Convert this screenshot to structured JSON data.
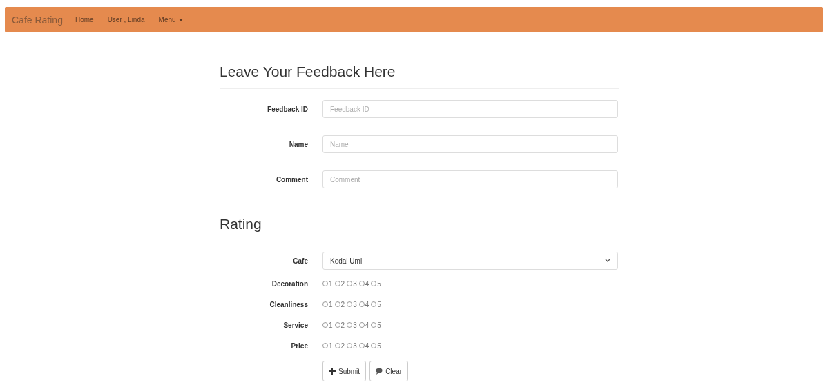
{
  "navbar": {
    "brand": "Cafe Rating",
    "links": [
      {
        "label": "Home",
        "kind": "link"
      },
      {
        "label": "User , Linda",
        "kind": "link"
      },
      {
        "label": "Menu",
        "kind": "dropdown"
      }
    ]
  },
  "feedback": {
    "title": "Leave Your Feedback Here",
    "fields": [
      {
        "label": "Feedback ID",
        "placeholder": "Feedback ID"
      },
      {
        "label": "Name",
        "placeholder": "Name"
      },
      {
        "label": "Comment",
        "placeholder": "Comment"
      }
    ]
  },
  "rating": {
    "title": "Rating",
    "cafe": {
      "label": "Cafe",
      "value": "Kedai Umi"
    },
    "criteria": [
      {
        "label": "Decoration",
        "options": [
          {
            "label": "1",
            "selected": false
          },
          {
            "label": "2",
            "selected": false
          },
          {
            "label": "3",
            "selected": false
          },
          {
            "label": "4",
            "selected": false
          },
          {
            "label": "5",
            "selected": false
          }
        ]
      },
      {
        "label": "Cleanliness",
        "options": [
          {
            "label": "1",
            "selected": false
          },
          {
            "label": "2",
            "selected": false
          },
          {
            "label": "3",
            "selected": false
          },
          {
            "label": "4",
            "selected": false
          },
          {
            "label": "5",
            "selected": false
          }
        ]
      },
      {
        "label": "Service",
        "options": [
          {
            "label": "1",
            "selected": false
          },
          {
            "label": "2",
            "selected": false
          },
          {
            "label": "3",
            "selected": false
          },
          {
            "label": "4",
            "selected": false
          },
          {
            "label": "5",
            "selected": false
          }
        ]
      },
      {
        "label": "Price",
        "options": [
          {
            "label": "1",
            "selected": false
          },
          {
            "label": "2",
            "selected": false
          },
          {
            "label": "3",
            "selected": false
          },
          {
            "label": "4",
            "selected": false
          },
          {
            "label": "5",
            "selected": false
          }
        ]
      }
    ]
  },
  "buttons": [
    {
      "label": "Submit",
      "kind": "submit"
    },
    {
      "label": "Clear",
      "kind": "clear"
    }
  ]
}
